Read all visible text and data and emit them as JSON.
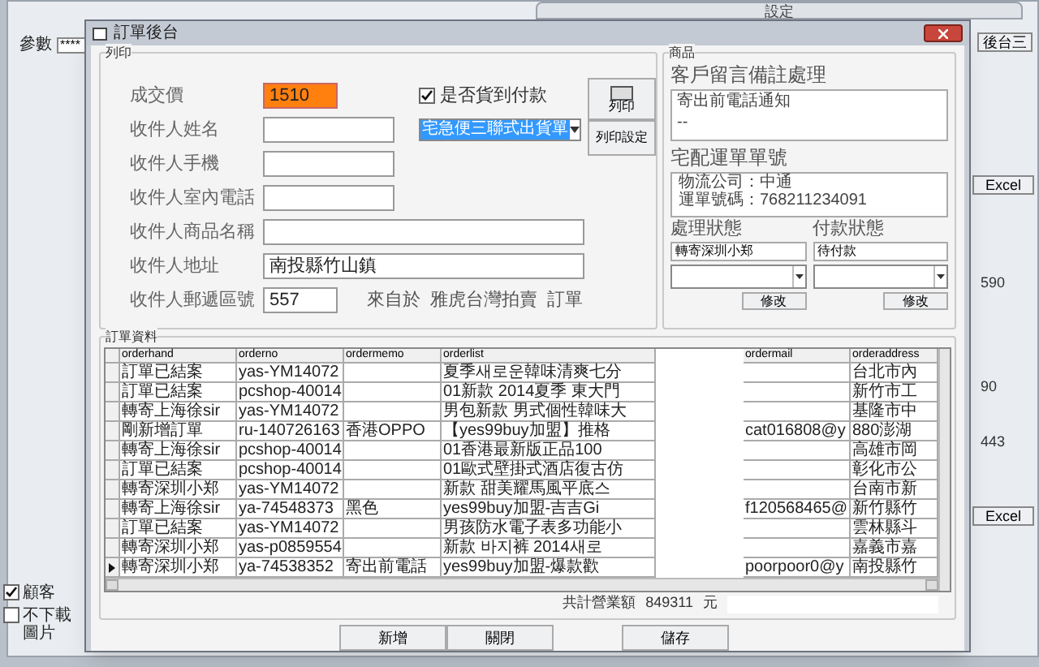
{
  "background": {
    "param_label": "參數",
    "param_value": "****",
    "tab": "設定",
    "side_button": "後台三",
    "excel_buttons": [
      "Excel",
      "Excel"
    ],
    "numbers": [
      "590",
      "90",
      "443"
    ],
    "checkboxes": [
      {
        "label": "顧客",
        "checked": true
      },
      {
        "label": "不下載圖片",
        "checked": false
      }
    ]
  },
  "dialog": {
    "title": "訂單後台",
    "print_group": {
      "title": "列印",
      "fields": [
        {
          "label": "成交價",
          "value": "1510",
          "kind": "short",
          "highlighted": true
        },
        {
          "label": "收件人姓名",
          "kind": "medium",
          "highlighted": false
        },
        {
          "label": "收件人手機",
          "kind": "medium",
          "highlighted": false
        },
        {
          "label": "收件人室內電話",
          "kind": "medium",
          "highlighted": false
        },
        {
          "label": "收件人商品名稱",
          "kind": "wide",
          "highlighted": false
        },
        {
          "label": "收件人地址",
          "value": "南投縣竹山鎮",
          "kind": "wide",
          "highlighted": false
        },
        {
          "label": "收件人郵遞區號",
          "value": "557",
          "kind": "short",
          "highlighted": false
        }
      ],
      "cod": {
        "label": "是否貨到付款",
        "checked": true
      },
      "template": {
        "value": "宅急便三聯式出貨單"
      },
      "print_button": "列印",
      "print_settings_button": "列印設定",
      "source": "來自於  雅虎台灣拍賣  訂單"
    },
    "product_group": {
      "title": "商品",
      "memo_label": "客戶留言備註處理",
      "memo_lines": [
        "寄出前電話通知",
        "--"
      ],
      "tracking_label": "宅配運單單號",
      "tracking_lines": [
        "物流公司：中通",
        "運單號碼：768211234091"
      ],
      "status": [
        {
          "label": "處理狀態",
          "value": "轉寄深圳小郑",
          "button": "修改"
        },
        {
          "label": "付款狀態",
          "value": "待付款",
          "button": "修改"
        }
      ]
    },
    "table": {
      "title": "訂單資料",
      "columns": [
        "orderhand",
        "orderno",
        "ordermemo",
        "orderlist",
        "ordermail",
        "orderaddress"
      ],
      "rows": [
        {
          "cells": [
            "訂單已結案",
            "yas-YM14072",
            "",
            "夏季새로운韓味清爽七分",
            "",
            "台北市內"
          ],
          "selected": false
        },
        {
          "cells": [
            "訂單已結案",
            "pcshop-40014",
            "",
            "01新款 2014夏季 東大門",
            "",
            "新竹市工"
          ],
          "selected": false
        },
        {
          "cells": [
            "轉寄上海徐sir",
            "yas-YM14072",
            "",
            "男包新款 男式個性韓味大",
            "",
            "基隆市中"
          ],
          "selected": false
        },
        {
          "cells": [
            "剛新增訂單",
            "ru-140726163",
            "香港OPPO",
            "【yes99buy加盟】推格",
            "cat016808@y",
            "880澎湖"
          ],
          "selected": false
        },
        {
          "cells": [
            "轉寄上海徐sir",
            "pcshop-40014",
            "",
            "01香港最新版正品100",
            "",
            "高雄市岡"
          ],
          "selected": false
        },
        {
          "cells": [
            "訂單已結案",
            "pcshop-40014",
            "",
            "01歐式壁掛式酒店復古仿",
            "",
            "彰化市公"
          ],
          "selected": false
        },
        {
          "cells": [
            "轉寄深圳小郑",
            "yas-YM14072",
            "",
            "新款 甜美耀馬風平底스",
            "",
            "台南市新"
          ],
          "selected": false
        },
        {
          "cells": [
            "轉寄上海徐sir",
            "ya-74548373",
            "黑色",
            "yes99buy加盟-吉吉Gi",
            "f120568465@",
            "新竹縣竹"
          ],
          "selected": false
        },
        {
          "cells": [
            "訂單已結案",
            "yas-YM14072",
            "",
            "男孩防水電子表多功能小",
            "",
            "雲林縣斗"
          ],
          "selected": false
        },
        {
          "cells": [
            "轉寄深圳小郑",
            "yas-p0859554",
            "",
            "新款 바지裤 2014새로",
            "",
            "嘉義市嘉"
          ],
          "selected": false
        },
        {
          "cells": [
            "轉寄深圳小郑",
            "ya-74538352",
            "寄出前電話",
            "yes99buy加盟-爆款歡",
            "poorpoor0@y",
            "南投縣竹"
          ],
          "selected": true
        }
      ]
    },
    "total": {
      "label": "共計營業額",
      "value": "849311",
      "unit": "元"
    },
    "buttons": [
      "新增",
      "關閉",
      "儲存"
    ]
  }
}
